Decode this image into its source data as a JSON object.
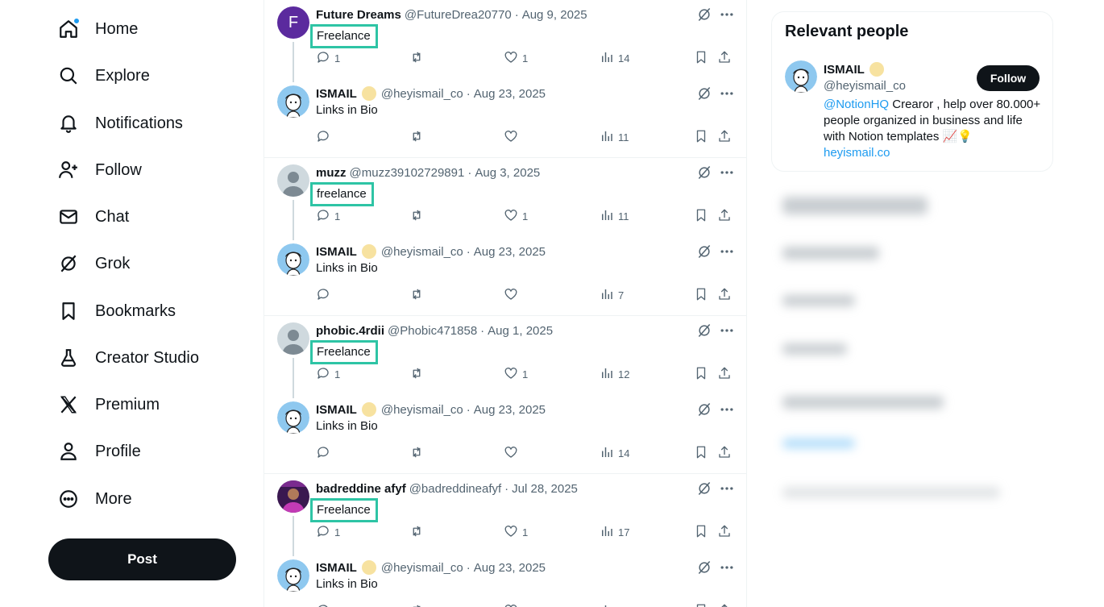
{
  "nav": {
    "items": [
      {
        "label": "Home",
        "icon": "home-icon"
      },
      {
        "label": "Explore",
        "icon": "search-icon"
      },
      {
        "label": "Notifications",
        "icon": "bell-icon"
      },
      {
        "label": "Follow",
        "icon": "add-person-icon"
      },
      {
        "label": "Chat",
        "icon": "envelope-icon"
      },
      {
        "label": "Grok",
        "icon": "grok-icon"
      },
      {
        "label": "Bookmarks",
        "icon": "bookmark-icon"
      },
      {
        "label": "Creator Studio",
        "icon": "flask-icon"
      },
      {
        "label": "Premium",
        "icon": "x-logo-icon"
      },
      {
        "label": "Profile",
        "icon": "person-icon"
      },
      {
        "label": "More",
        "icon": "more-circle-icon"
      }
    ],
    "post_label": "Post"
  },
  "threads": [
    {
      "original": {
        "name": "Future Dreams",
        "handle": "@FutureDrea20770",
        "date": "Aug 9, 2025",
        "text": "Freelance",
        "avatar_letter": "F",
        "replies": "1",
        "likes": "1",
        "views": "14"
      },
      "reply": {
        "name": "ISMAIL",
        "handle": "@heyismail_co",
        "date": "Aug 23, 2025",
        "text": "Links in Bio",
        "views": "11"
      }
    },
    {
      "original": {
        "name": "muzz",
        "handle": "@muzz39102729891",
        "date": "Aug 3, 2025",
        "text": "freelance",
        "replies": "1",
        "likes": "1",
        "views": "11"
      },
      "reply": {
        "name": "ISMAIL",
        "handle": "@heyismail_co",
        "date": "Aug 23, 2025",
        "text": "Links in Bio",
        "views": "7"
      }
    },
    {
      "original": {
        "name": "phobic.4rdii",
        "handle": "@Phobic471858",
        "date": "Aug 1, 2025",
        "text": "Freelance",
        "replies": "1",
        "likes": "1",
        "views": "12"
      },
      "reply": {
        "name": "ISMAIL",
        "handle": "@heyismail_co",
        "date": "Aug 23, 2025",
        "text": "Links in Bio",
        "views": "14"
      }
    },
    {
      "original": {
        "name": "badreddine afyf",
        "handle": "@badreddineafyf",
        "date": "Jul 28, 2025",
        "text": "Freelance",
        "replies": "1",
        "likes": "1",
        "views": "17"
      },
      "reply": {
        "name": "ISMAIL",
        "handle": "@heyismail_co",
        "date": "Aug 23, 2025",
        "text": "Links in Bio",
        "views": ""
      }
    }
  ],
  "relevant": {
    "title": "Relevant people",
    "name": "ISMAIL",
    "handle": "@heyismail_co",
    "follow_label": "Follow",
    "bio_mention": "@NotionHQ",
    "bio_text": " Crearor , help over 80.000+ people organized in business and life with Notion templates 📈💡",
    "bio_link": "heyismail.co"
  },
  "colors": {
    "accent": "#1d9bf0",
    "highlight": "#2ec4a5",
    "text": "#0f1419",
    "muted": "#536471"
  }
}
